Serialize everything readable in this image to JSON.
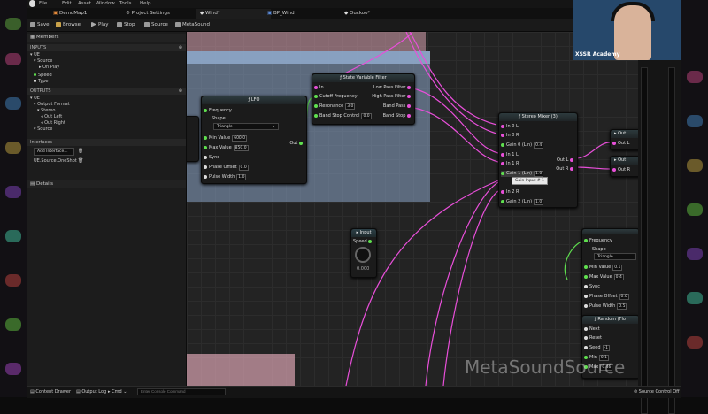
{
  "menu": [
    "File",
    "Edit",
    "Asset",
    "Window",
    "Tools",
    "Help"
  ],
  "tabs": [
    {
      "label": "DemoMap1",
      "active": false
    },
    {
      "label": "Project Settings",
      "active": false
    },
    {
      "label": "Wind*",
      "active": true
    },
    {
      "label": "BP_Wind",
      "active": false
    },
    {
      "label": "Ouckoo*",
      "active": false
    }
  ],
  "toolbar": {
    "save": "Save",
    "browse": "Browse",
    "play": "Play",
    "stop": "Stop",
    "source": "Source",
    "metasound": "MetaSound"
  },
  "members_panel": {
    "title": "Members",
    "inputs_header": "INPUTS",
    "inputs": [
      "UE",
      "Source",
      "On Play",
      "Speed",
      "Type"
    ],
    "outputs_header": "OUTPUTS",
    "outputs": [
      "UE",
      "Output Format",
      "Stereo",
      "Out Left",
      "Out Right",
      "Source"
    ],
    "interfaces_header": "Interfaces",
    "add_interface": "Add Interface...",
    "interface_item": "UE.Source.OneShot",
    "details_title": "Details"
  },
  "nodes": {
    "lfo": {
      "title": "LFO",
      "frequency": "Frequency",
      "shape_label": "Shape",
      "shape_value": "Triangle",
      "min_value_label": "Min Value",
      "min_value": "600.0",
      "max_value_label": "Max Value",
      "max_value": "850.0",
      "sync": "Sync",
      "phase_offset_label": "Phase Offset",
      "phase_offset": "0.0",
      "pulse_width_label": "Pulse Width",
      "pulse_width": "1.0",
      "out": "Out"
    },
    "svf": {
      "title": "State Variable Filter",
      "in": "In",
      "cutoff": "Cutoff Frequency",
      "resonance_label": "Resonance",
      "resonance": "3.0",
      "bandstop_label": "Band Stop Control",
      "bandstop": "0.0",
      "lowpass": "Low Pass Filter",
      "highpass": "High Pass Filter",
      "bandpass": "Band Pass",
      "bandstop_out": "Band Stop"
    },
    "stereo_mixer": {
      "title": "Stereo Mixer (3)",
      "in0l": "In 0 L",
      "in0r": "In 0 R",
      "gain0_label": "Gain 0 (Lin)",
      "gain0": "0.4",
      "in1l": "In 1 L",
      "in1r": "In 1 R",
      "gain1_label": "Gain 1 (Lin)",
      "gain1": "1.0",
      "in2r": "In 2 R",
      "gain2_label": "Gain 2 (Lin)",
      "gain2": "1.0",
      "outl": "Out L",
      "outr": "Out R",
      "tooltip": "Gain Input # 1"
    },
    "input": {
      "title": "Input",
      "speed": "Speed",
      "knob_value": "0.000"
    },
    "lfo2": {
      "frequency": "Frequency",
      "shape_label": "Shape",
      "shape_value": "Triangle",
      "min_value_label": "Min Value",
      "min_value": "0.1",
      "max_value_label": "Max Value",
      "max_value": "0.4",
      "sync": "Sync",
      "phase_offset_label": "Phase Offset",
      "phase_offset": "0.0",
      "pulse_width_label": "Pulse Width",
      "pulse_width": "0.5"
    },
    "random": {
      "title": "Random (Flo",
      "next": "Next",
      "reset": "Reset",
      "seed_label": "Seed",
      "seed": "-1",
      "min_label": "Min",
      "min": "0.1",
      "max_label": "Max",
      "max": "0.46"
    },
    "out_small_1": {
      "title": "Out",
      "out": "Out L"
    },
    "out_small_2": {
      "title": "Out",
      "out": "Out R"
    }
  },
  "overlay_text": "MetaSoundSource",
  "webcam_caption": "XSSR Academy",
  "bottom": {
    "content_drawer": "Content Drawer",
    "output_log": "Output Log",
    "cmd": "Cmd",
    "cmd_placeholder": "Enter Console Command",
    "source_control": "Source Control Off"
  },
  "colors": {
    "audio_pin": "#e84fd9",
    "float_pin": "#5fe04f",
    "graph_bg": "#232323",
    "comment_blue": "#8da6c8",
    "comment_pink": "#d9a3b0"
  }
}
